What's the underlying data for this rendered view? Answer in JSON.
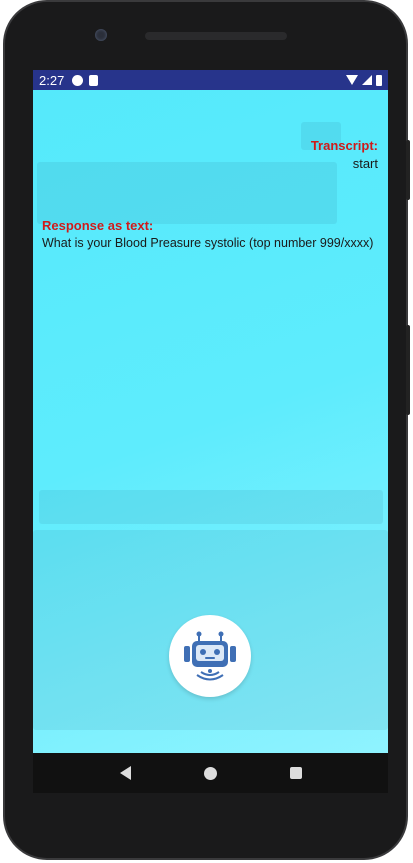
{
  "status_bar": {
    "time": "2:27"
  },
  "transcript": {
    "label": "Transcript:",
    "text": "start"
  },
  "response": {
    "label": "Response as text:",
    "text": "What is your Blood Preasure systolic (top number 999/xxxx)"
  },
  "colors": {
    "status_bar": "#27348b",
    "app_background": "#5eecfd",
    "label_red": "#d01a1a",
    "bot_icon_blue": "#3f6fb5"
  },
  "icons": {
    "assistant_button": "robot-headset-icon"
  }
}
